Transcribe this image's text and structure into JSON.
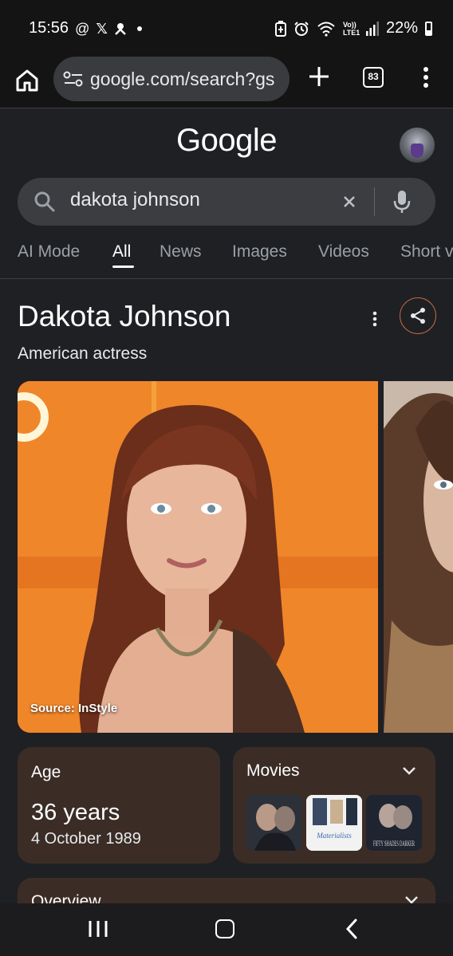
{
  "status_bar": {
    "time": "15:56",
    "battery": "22%",
    "net_label": "Vo)) LTE1",
    "left_icons": [
      "at-icon",
      "x-logo-icon",
      "drone-icon",
      "dot-icon"
    ],
    "right_icons": [
      "battery-saver-icon",
      "alarm-icon",
      "wifi-icon",
      "signal-icon"
    ]
  },
  "browser": {
    "url": "google.com/search?gs",
    "tab_count": "83"
  },
  "google": {
    "logo": "Google",
    "search_query": "dakota johnson"
  },
  "tabs": [
    {
      "label": "AI Mode"
    },
    {
      "label": "All",
      "active": true
    },
    {
      "label": "News"
    },
    {
      "label": "Images"
    },
    {
      "label": "Videos"
    },
    {
      "label": "Short v"
    }
  ],
  "knowledge_panel": {
    "title": "Dakota Johnson",
    "subtitle": "American actress",
    "image_source": "Source: InStyle"
  },
  "cards": {
    "age": {
      "label": "Age",
      "value": "36 years",
      "date": "4 October 1989"
    },
    "movies": {
      "label": "Movies",
      "posters": [
        "Fifty Shades poster",
        "Materialists",
        "FIFTY SHADES DARKER"
      ]
    },
    "overview": {
      "label": "Overview"
    }
  },
  "colors": {
    "background": "#1f2023",
    "card": "#3b2d26",
    "accent_share": "#c26a45"
  }
}
